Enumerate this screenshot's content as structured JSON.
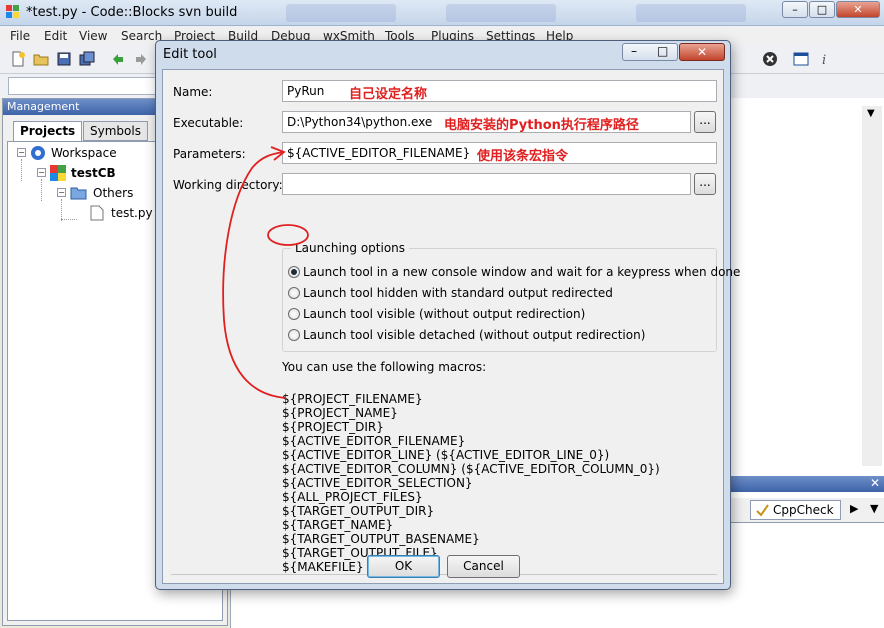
{
  "window": {
    "title": "*test.py - Code::Blocks svn build"
  },
  "menu": [
    "File",
    "Edit",
    "View",
    "Search",
    "Project",
    "Build",
    "Debug",
    "wxSmith",
    "Tools",
    "Plugins",
    "Settings",
    "Help"
  ],
  "management": {
    "header": "Management",
    "tabs": [
      "Projects",
      "Symbols"
    ],
    "tree": {
      "workspace": "Workspace",
      "project": "testCB",
      "folder": "Others",
      "file": "test.py"
    }
  },
  "logs": {
    "tab": "CppCheck"
  },
  "dialog": {
    "title": "Edit tool",
    "name_label": "Name:",
    "name_value": "PyRun",
    "executable_label": "Executable:",
    "executable_value": "D:\\Python34\\python.exe",
    "parameters_label": "Parameters:",
    "parameters_value": "${ACTIVE_EDITOR_FILENAME}",
    "workdir_label": "Working directory:",
    "workdir_value": "",
    "browse_label": "...",
    "launch_group_title": "Launching options",
    "launch_options": [
      "Launch tool in a new console window and wait for a keypress when done",
      "Launch tool hidden with standard output redirected",
      "Launch tool visible (without output redirection)",
      "Launch tool visible detached (without output redirection)"
    ],
    "selected_option": 0,
    "macros_intro": "You can use the following macros:",
    "macros": [
      "${PROJECT_FILENAME}",
      "${PROJECT_NAME}",
      "${PROJECT_DIR}",
      "${ACTIVE_EDITOR_FILENAME}",
      "${ACTIVE_EDITOR_LINE} (${ACTIVE_EDITOR_LINE_0})",
      "${ACTIVE_EDITOR_COLUMN} (${ACTIVE_EDITOR_COLUMN_0})",
      "${ACTIVE_EDITOR_SELECTION}",
      "${ALL_PROJECT_FILES}",
      "${TARGET_OUTPUT_DIR}",
      "${TARGET_NAME}",
      "${TARGET_OUTPUT_BASENAME}",
      "${TARGET_OUTPUT_FILE}",
      "${MAKEFILE}"
    ],
    "ok_label": "OK",
    "cancel_label": "Cancel"
  },
  "annotations": {
    "name_note": "自己设定名称",
    "executable_note": "电脑安装的Python执行程序路径",
    "parameters_note": "使用该条宏指令",
    "color": "#e02020"
  },
  "icons": {
    "window_close": "close-icon",
    "window_minimize": "minimize-icon",
    "window_maximize": "maximize-icon"
  }
}
